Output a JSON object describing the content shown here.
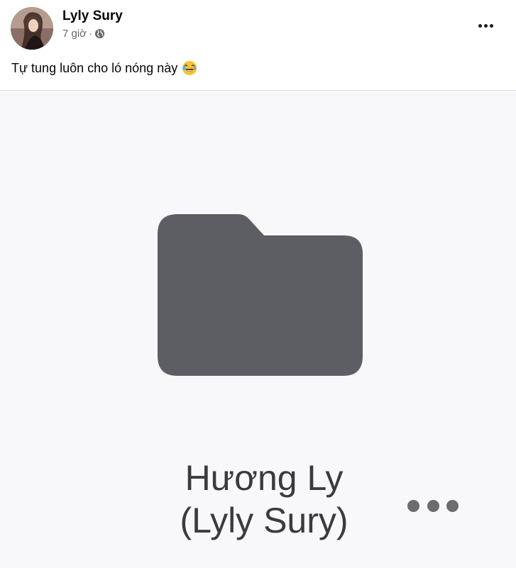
{
  "post": {
    "author": "Lyly Sury",
    "time": "7 giờ",
    "separator": "·",
    "privacy_icon": "globe-icon",
    "caption": "Tự tung luôn cho ló nóng này",
    "caption_emoji": "laughing-crying-emoji",
    "options_icon": "more-horizontal-icon"
  },
  "image": {
    "folder_icon": "folder-icon",
    "title_line1": "Hương Ly",
    "title_line2": "(Lyly Sury)",
    "options_icon": "more-horizontal-icon"
  }
}
